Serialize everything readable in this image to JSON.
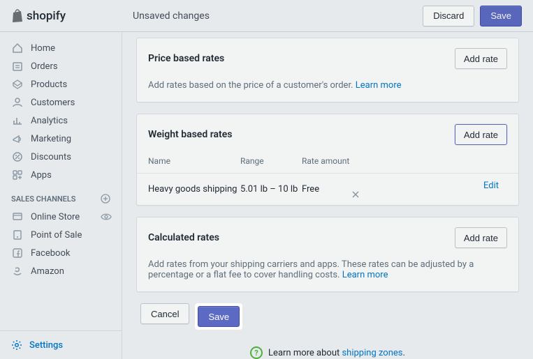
{
  "brand": "shopify",
  "header": {
    "title": "Unsaved changes",
    "discard": "Discard",
    "save": "Save"
  },
  "sidebar": {
    "items": [
      {
        "label": "Home",
        "icon": "home-icon"
      },
      {
        "label": "Orders",
        "icon": "orders-icon"
      },
      {
        "label": "Products",
        "icon": "products-icon"
      },
      {
        "label": "Customers",
        "icon": "customers-icon"
      },
      {
        "label": "Analytics",
        "icon": "analytics-icon"
      },
      {
        "label": "Marketing",
        "icon": "marketing-icon"
      },
      {
        "label": "Discounts",
        "icon": "discounts-icon"
      },
      {
        "label": "Apps",
        "icon": "apps-icon"
      }
    ],
    "section_label": "SALES CHANNELS",
    "channels": [
      {
        "label": "Online Store",
        "icon": "online-store-icon",
        "has_eye": true
      },
      {
        "label": "Point of Sale",
        "icon": "pos-icon"
      },
      {
        "label": "Facebook",
        "icon": "facebook-icon"
      },
      {
        "label": "Amazon",
        "icon": "amazon-icon"
      }
    ],
    "settings_label": "Settings"
  },
  "cards": {
    "price": {
      "title": "Price based rates",
      "add": "Add rate",
      "desc": "Add rates based on the price of a customer's order.",
      "learn": "Learn more"
    },
    "weight": {
      "title": "Weight based rates",
      "add": "Add rate",
      "columns": {
        "name": "Name",
        "range": "Range",
        "amount": "Rate amount"
      },
      "rows": [
        {
          "name": "Heavy goods shipping",
          "range": "5.01 lb – 10 lb",
          "amount": "Free",
          "edit": "Edit"
        }
      ]
    },
    "calc": {
      "title": "Calculated rates",
      "add": "Add rate",
      "desc": "Add rates from your shipping carriers and apps. These rates can be adjusted by a percentage or a flat fee to cover handling costs.",
      "learn": "Learn more"
    }
  },
  "footer_actions": {
    "cancel": "Cancel",
    "save": "Save"
  },
  "info": {
    "prefix": "Learn more about ",
    "link": "shipping zones"
  }
}
